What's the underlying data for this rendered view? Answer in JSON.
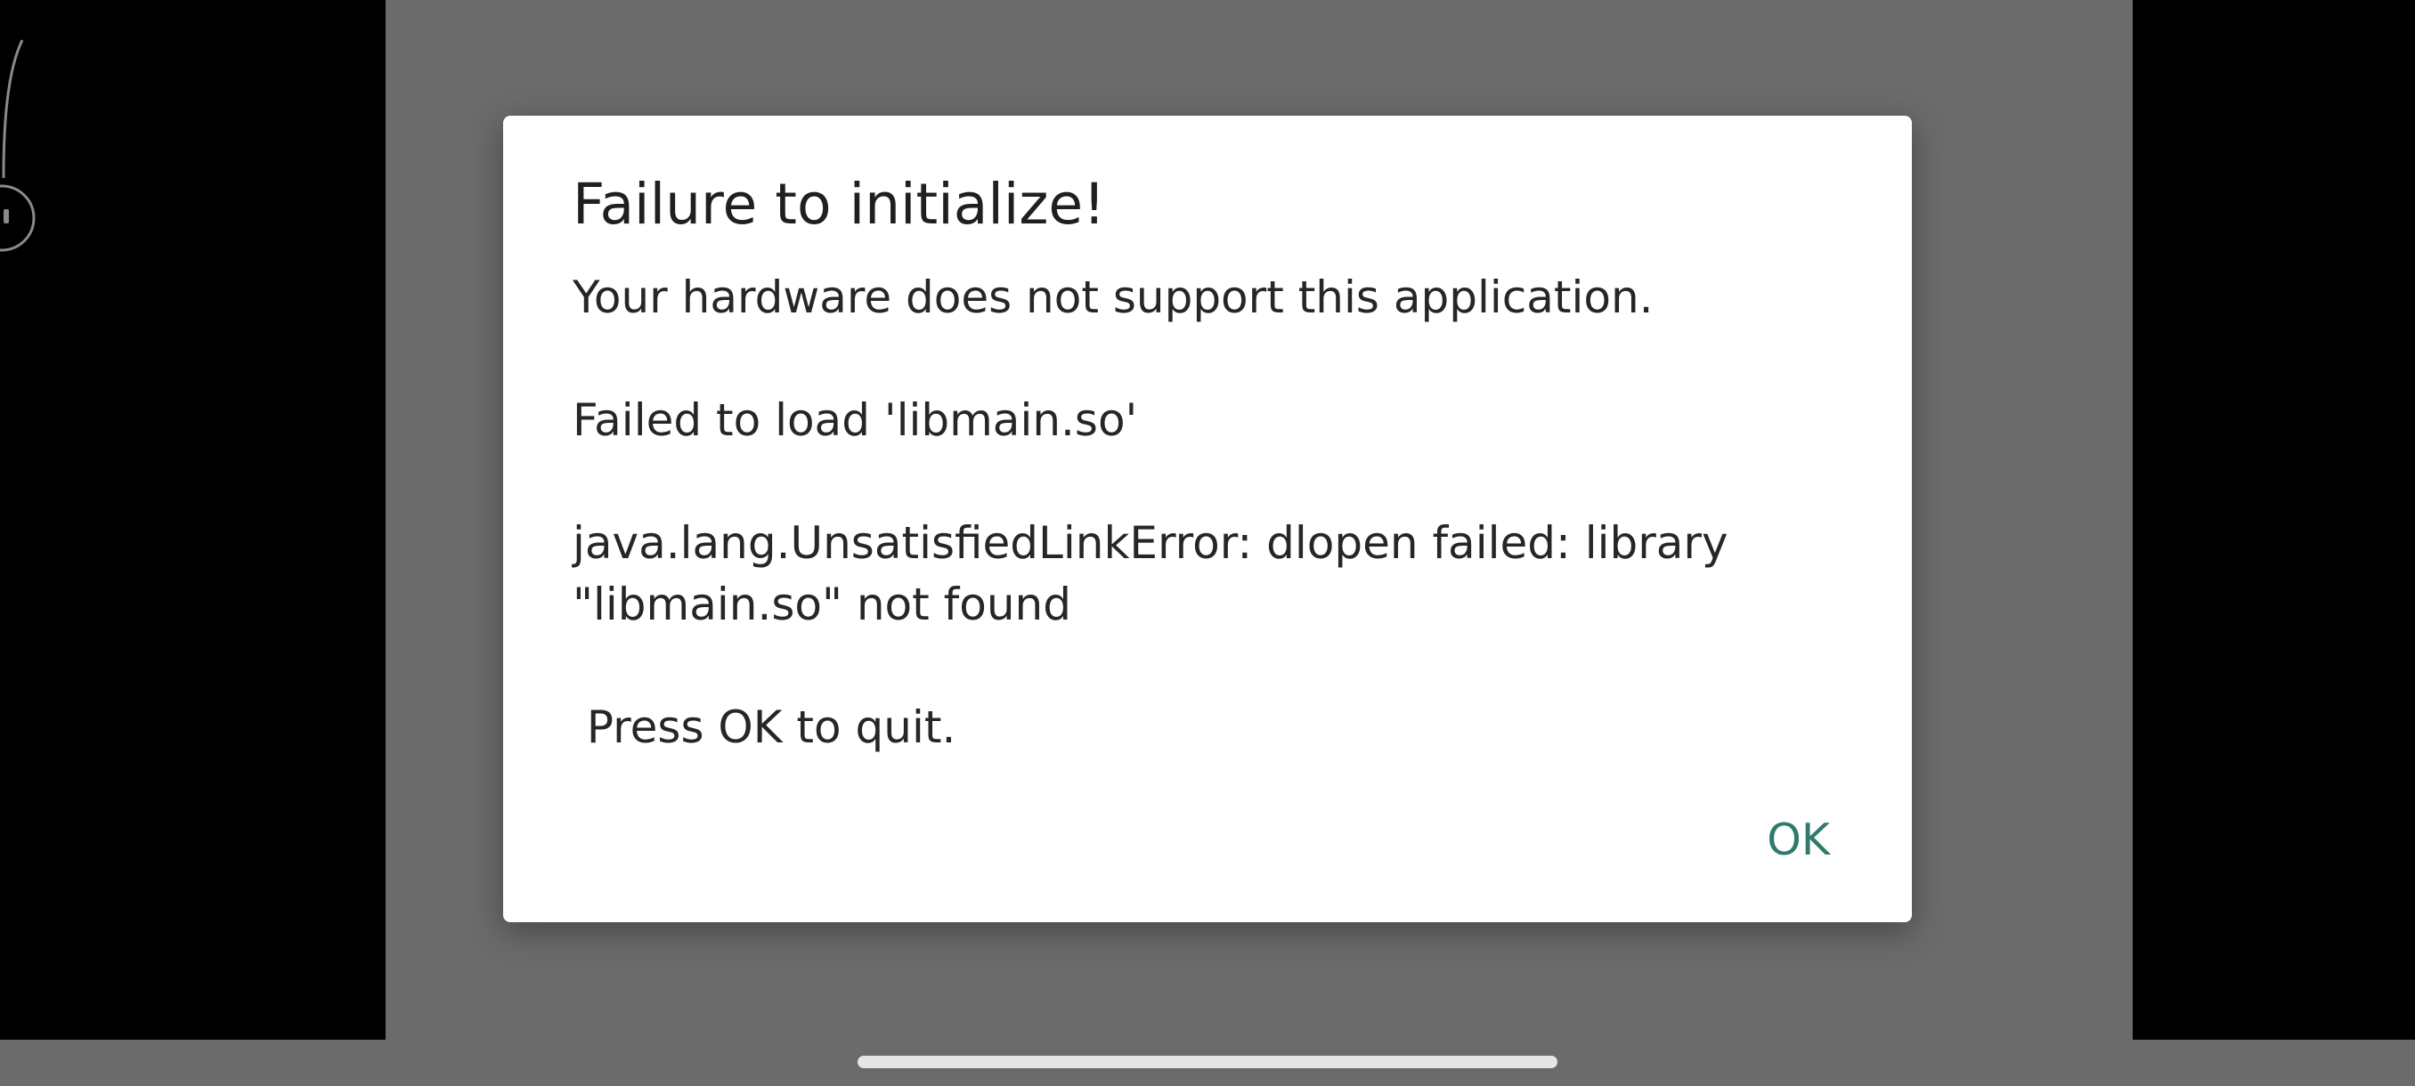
{
  "dialog": {
    "title": "Failure to initialize!",
    "message": "Your hardware does not support this application.\n\nFailed to load 'libmain.so'\n\njava.lang.UnsatisfiedLinkError: dlopen failed: library\n\"libmain.so\" not found\n\n Press OK to quit.",
    "ok_label": "OK"
  },
  "colors": {
    "scrim": "#6b6b6b",
    "dialog_background": "#ffffff",
    "accent": "#2f7a6c",
    "side_bars": "#000000"
  },
  "icons": {
    "camera_cutout": "earbud-outline-icon",
    "home_indicator": "home-indicator-bar"
  }
}
